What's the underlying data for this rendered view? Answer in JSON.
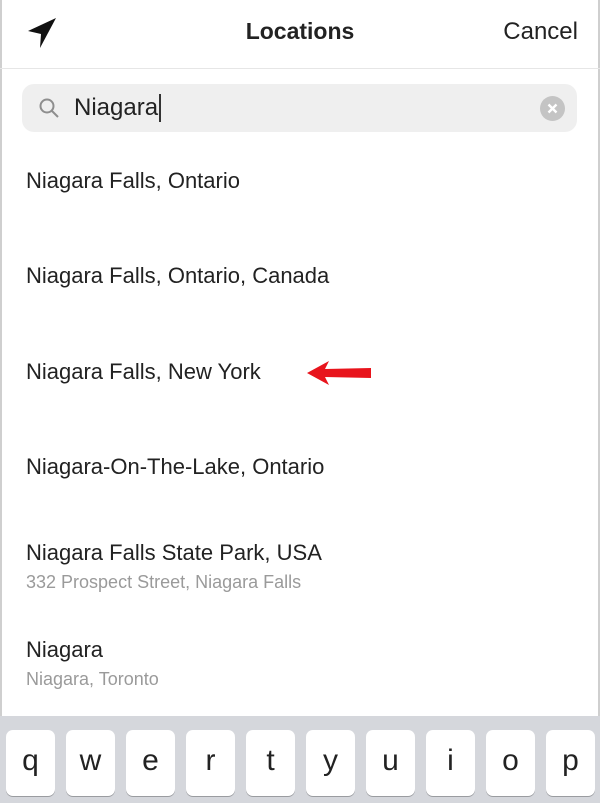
{
  "nav": {
    "title": "Locations",
    "cancel_label": "Cancel",
    "left_icon": "location-arrow-icon"
  },
  "search": {
    "value": "Niagara",
    "icon": "search-icon",
    "clear_icon": "clear-icon"
  },
  "results": [
    {
      "title": "Niagara Falls, Ontario",
      "subtitle": ""
    },
    {
      "title": "Niagara Falls, Ontario, Canada",
      "subtitle": ""
    },
    {
      "title": "Niagara Falls, New York",
      "subtitle": ""
    },
    {
      "title": "Niagara-On-The-Lake, Ontario",
      "subtitle": ""
    },
    {
      "title": "Niagara Falls State Park, USA",
      "subtitle": "332 Prospect Street, Niagara Falls"
    },
    {
      "title": "Niagara",
      "subtitle": "Niagara, Toronto"
    }
  ],
  "annotation": {
    "icon": "red-arrow-icon",
    "color": "#e8141c",
    "points_to": "Niagara Falls, New York"
  },
  "keyboard": {
    "keys": [
      "q",
      "w",
      "e",
      "r",
      "t",
      "y",
      "u",
      "i",
      "o",
      "p"
    ]
  }
}
